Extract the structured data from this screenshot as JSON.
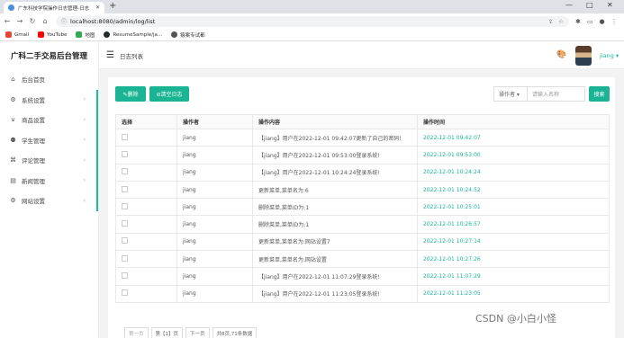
{
  "browser": {
    "tab_title": "广东科技学院操作日志管理-日志",
    "url": "localhost:8080/admin/log/list",
    "bookmarks": [
      {
        "label": "Gmail",
        "color": "#ea4335"
      },
      {
        "label": "YouTube",
        "color": "#ff0000"
      },
      {
        "label": "地图",
        "color": "#34a853"
      },
      {
        "label": "ResumeSample/ja...",
        "color": "#24292e"
      },
      {
        "label": "猿案专试都",
        "color": "#555555"
      }
    ]
  },
  "sidebar": {
    "brand": "广科二手交易后台管理",
    "items": [
      {
        "label": "后台首页",
        "icon": "home-icon",
        "glyph": "⌂",
        "chev": ""
      },
      {
        "label": "系统设置",
        "icon": "gear-icon",
        "glyph": "⚙",
        "chev": "›"
      },
      {
        "label": "商品设置",
        "icon": "basket-icon",
        "glyph": "⊍",
        "chev": "›"
      },
      {
        "label": "学生管理",
        "icon": "users-icon",
        "glyph": "⚉",
        "chev": "›"
      },
      {
        "label": "评论管理",
        "icon": "command-icon",
        "glyph": "⌘",
        "chev": "›"
      },
      {
        "label": "新闻管理",
        "icon": "news-icon",
        "glyph": "▤",
        "chev": "›"
      },
      {
        "label": "网站设置",
        "icon": "gear-icon",
        "glyph": "⚙",
        "chev": "›"
      }
    ]
  },
  "topbar": {
    "breadcrumb": "日志列表",
    "username": "jiang ▾"
  },
  "toolbar": {
    "delete_label": "✎删除",
    "clear_label": "⊘清空日志",
    "operator_select": "操作者 ▾",
    "search_placeholder": "请输入名称",
    "search_label": "搜索"
  },
  "table": {
    "headers": [
      "选择",
      "操作者",
      "操作内容",
      "操作时间"
    ],
    "rows": [
      {
        "operator": "jiang",
        "content": "【jiang】用户在2022-12-01 09:42:07更新了自己的密码!",
        "time": "2022-12-01 09:42:07"
      },
      {
        "operator": "jiang",
        "content": "【jiang】用户在2022-12-01 09:53:00登录系统!",
        "time": "2022-12-01 09:53:00"
      },
      {
        "operator": "jiang",
        "content": "【jiang】用户在2022-12-01 10:24:24登录系统!",
        "time": "2022-12-01 10:24:24"
      },
      {
        "operator": "jiang",
        "content": "更新菜单,菜单名为:6",
        "time": "2022-12-01 10:24:52"
      },
      {
        "operator": "jiang",
        "content": "删除菜单,菜单ID为:1",
        "time": "2022-12-01 10:25:01"
      },
      {
        "operator": "jiang",
        "content": "删除菜单,菜单ID为:1",
        "time": "2022-12-01 10:26:57"
      },
      {
        "operator": "jiang",
        "content": "更新菜单,菜单名为:网站设置7",
        "time": "2022-12-01 10:27:14"
      },
      {
        "operator": "jiang",
        "content": "更新菜单,菜单名为:网站设置",
        "time": "2022-12-01 10:27:26"
      },
      {
        "operator": "jiang",
        "content": "【jiang】用户在2022-12-01 11:07:29登录系统!",
        "time": "2022-12-01 11:07:29"
      },
      {
        "operator": "jiang",
        "content": "【jiang】用户在2022-12-01 11:23:05登录系统!",
        "time": "2022-12-01 11:23:05"
      }
    ]
  },
  "pager": {
    "prev": "第一页",
    "current": "第【1】页",
    "next": "下一页",
    "summary": "共8页,71条数据"
  },
  "watermark": "CSDN @小白小怪",
  "colors": {
    "accent": "#1ab394"
  }
}
